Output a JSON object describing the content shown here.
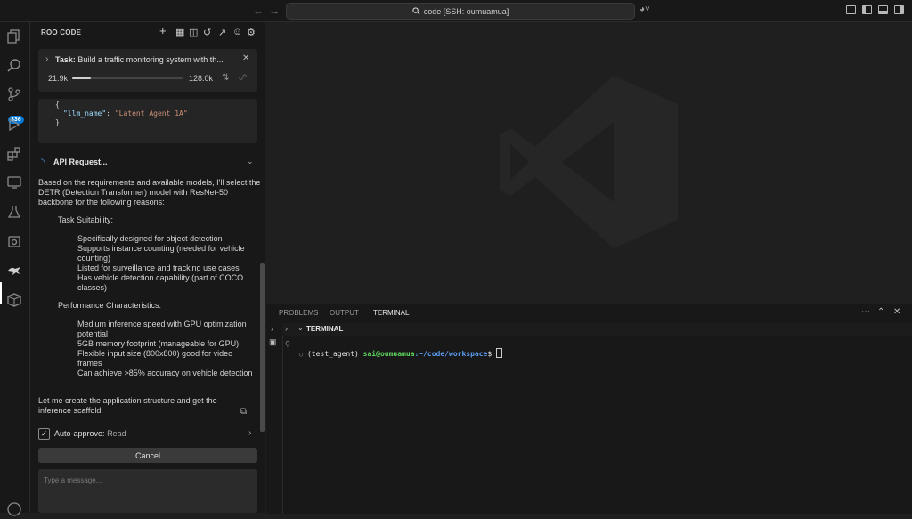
{
  "titlebar": {
    "search_label": "code [SSH: oumuamua]",
    "back_icon": "arrow-left-icon",
    "forward_icon": "arrow-right-icon"
  },
  "activity_bar": {
    "scm_badge": "336"
  },
  "sidebar": {
    "title": "ROO CODE",
    "task": {
      "label": "Task:",
      "text": "Build a traffic monitoring system with th...",
      "tokens_used": "21.9k",
      "tokens_max": "128.0k",
      "context_progress": 0.17
    },
    "code": {
      "line1": "{",
      "key": "\"llm_name\"",
      "colon": ": ",
      "value": "\"Latent Agent 1A\"",
      "line3": "}"
    },
    "api_request_label": "API Request...",
    "intro": "Based on the requirements and available models, I'll select the DETR (Detection Transformer) model with ResNet-50 backbone for the following reasons:",
    "section1": {
      "title": "Task Suitability:",
      "items": [
        "Specifically designed for object detection",
        "Supports instance counting (needed for vehicle counting)",
        "Listed for surveillance and tracking use cases",
        "Has vehicle detection capability (part of COCO classes)"
      ]
    },
    "section2": {
      "title": "Performance Characteristics:",
      "items": [
        "Medium inference speed with GPU optimization potential",
        "5GB memory footprint (manageable for GPU)",
        "Flexible input size (800x800) good for video frames",
        "Can achieve >85% accuracy on vehicle detection"
      ]
    },
    "closing": "Let me create the application structure and get the inference scaffold.",
    "auto_approve_label": "Auto-approve:",
    "auto_approve_value": "Read",
    "cancel_label": "Cancel",
    "message_placeholder": "Type a message..."
  },
  "panel": {
    "tabs": [
      "PROBLEMS",
      "OUTPUT",
      "TERMINAL"
    ],
    "terminal_title": "TERMINAL",
    "prompt_env": "(test_agent)",
    "prompt_user": "sai@oumuamua",
    "prompt_path": ":~/code/workspace",
    "prompt_symbol": "$"
  },
  "colors": {
    "accent": "#0078d4",
    "background": "#1f1f1f",
    "sidebar": "#181818"
  }
}
